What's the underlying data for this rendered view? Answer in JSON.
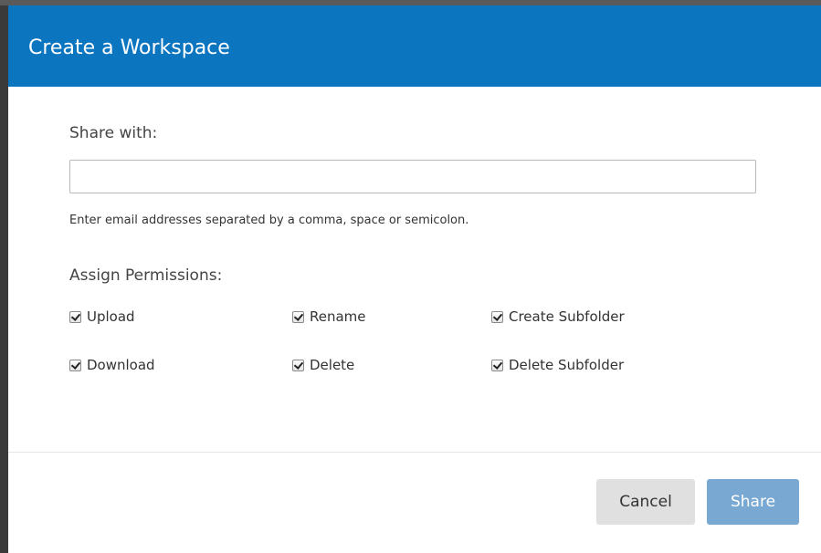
{
  "dialog": {
    "title": "Create a Workspace",
    "share_with_label": "Share with:",
    "email_input": {
      "value": "",
      "placeholder": ""
    },
    "help_text": "Enter email addresses separated by a comma, space or semicolon.",
    "permissions_label": "Assign Permissions:",
    "permissions": [
      {
        "label": "Upload",
        "checked": true
      },
      {
        "label": "Rename",
        "checked": true
      },
      {
        "label": "Create Subfolder",
        "checked": true
      },
      {
        "label": "Download",
        "checked": true
      },
      {
        "label": "Delete",
        "checked": true
      },
      {
        "label": "Delete Subfolder",
        "checked": true
      }
    ],
    "buttons": {
      "cancel_label": "Cancel",
      "share_label": "Share"
    }
  },
  "colors": {
    "header": "#0b75c0",
    "share_button": "#79a9d2",
    "cancel_button": "#e0e0e0"
  }
}
